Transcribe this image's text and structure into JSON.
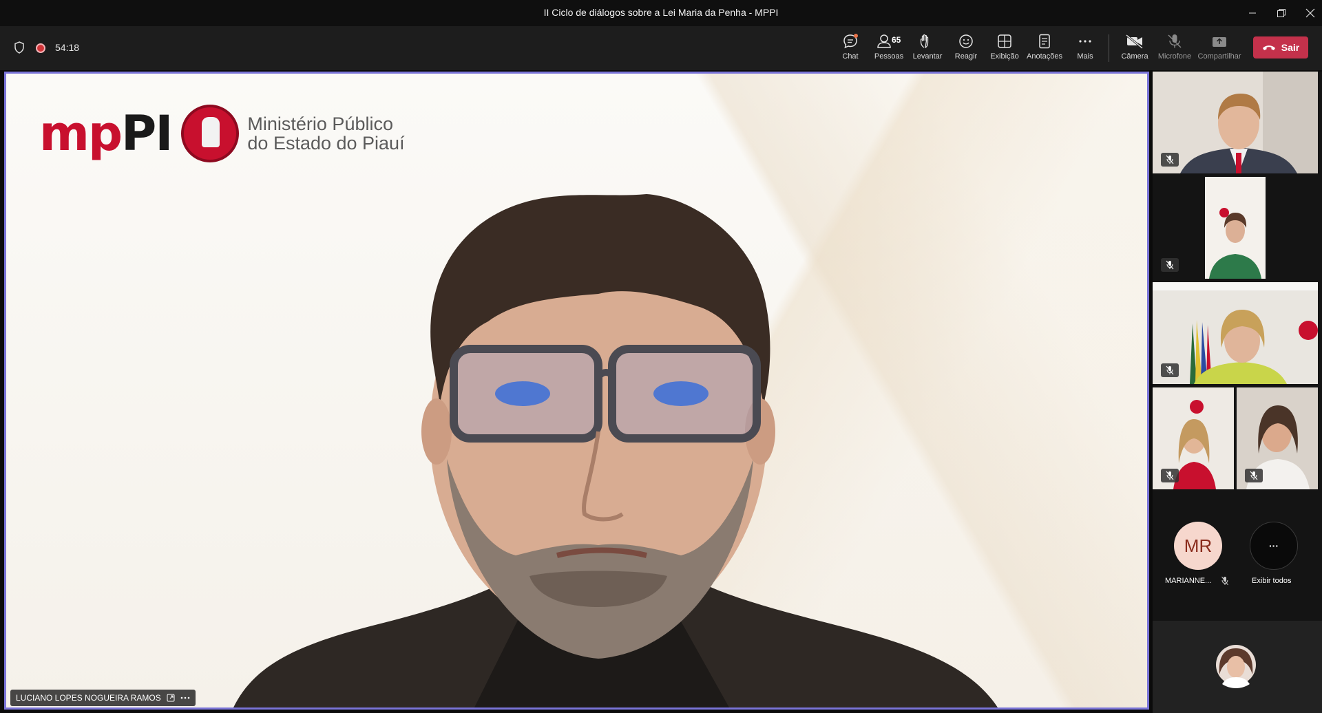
{
  "window": {
    "title": "II Ciclo de diálogos sobre a Lei Maria da Penha - MPPI"
  },
  "meeting": {
    "timer": "54:18"
  },
  "toolbar": {
    "chat": "Chat",
    "people_count": "65",
    "people": "Pessoas",
    "raise": "Levantar",
    "react": "Reagir",
    "view": "Exibição",
    "notes": "Anotações",
    "more": "Mais",
    "camera": "Câmera",
    "mic": "Microfone",
    "share": "Compartilhar",
    "leave": "Sair"
  },
  "stage": {
    "logo_mark_a": "mp",
    "logo_mark_b": "PI",
    "logo_line1": "Ministério Público",
    "logo_line2": "do Estado do Piauí",
    "speaker_name": "LUCIANO LOPES NOGUEIRA RAMOS"
  },
  "gallery": {
    "avatar_initials": "MR",
    "avatar_name": "MARIANNE...",
    "show_all_icon": "···",
    "show_all": "Exibir todos"
  },
  "colors": {
    "accent_border": "#7a74d8",
    "leave_button": "#c4314b",
    "brand_red": "#c8102e",
    "recording": "#d13438",
    "avatar_bg": "#f6d7cd",
    "avatar_text": "#8a2c1d"
  },
  "icons": [
    "shield-icon",
    "recording-icon",
    "chat-icon",
    "people-icon",
    "hand-icon",
    "smiley-icon",
    "grid-icon",
    "notes-icon",
    "more-icon",
    "camera-off-icon",
    "mic-off-icon",
    "share-icon",
    "phone-hangup-icon",
    "pop-out-icon",
    "ellipsis-icon"
  ]
}
